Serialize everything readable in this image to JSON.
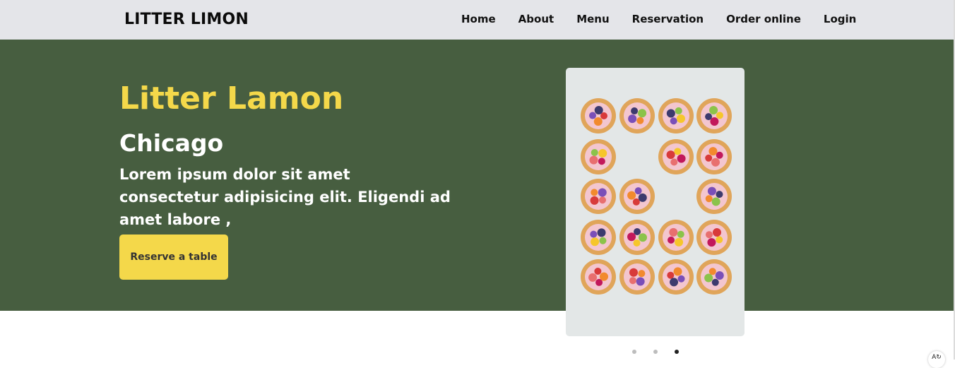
{
  "header": {
    "brand": "LITTER LIMON",
    "nav": [
      {
        "label": "Home"
      },
      {
        "label": "About"
      },
      {
        "label": "Menu"
      },
      {
        "label": "Reservation"
      },
      {
        "label": "Order online"
      },
      {
        "label": "Login"
      }
    ]
  },
  "hero": {
    "title": "Litter Lamon",
    "subtitle": "Chicago",
    "description": "Lorem ipsum dolor sit amet consectetur adipisicing elit. Eligendi ad amet labore ,",
    "cta_label": "Reserve a table"
  },
  "carousel": {
    "image_icon": "food-image",
    "slides": 3,
    "active_slide": 3
  },
  "colors": {
    "header_bg": "#e4e5e9",
    "hero_bg": "#475e40",
    "accent": "#f4d84a",
    "text_light": "#ffffff"
  }
}
